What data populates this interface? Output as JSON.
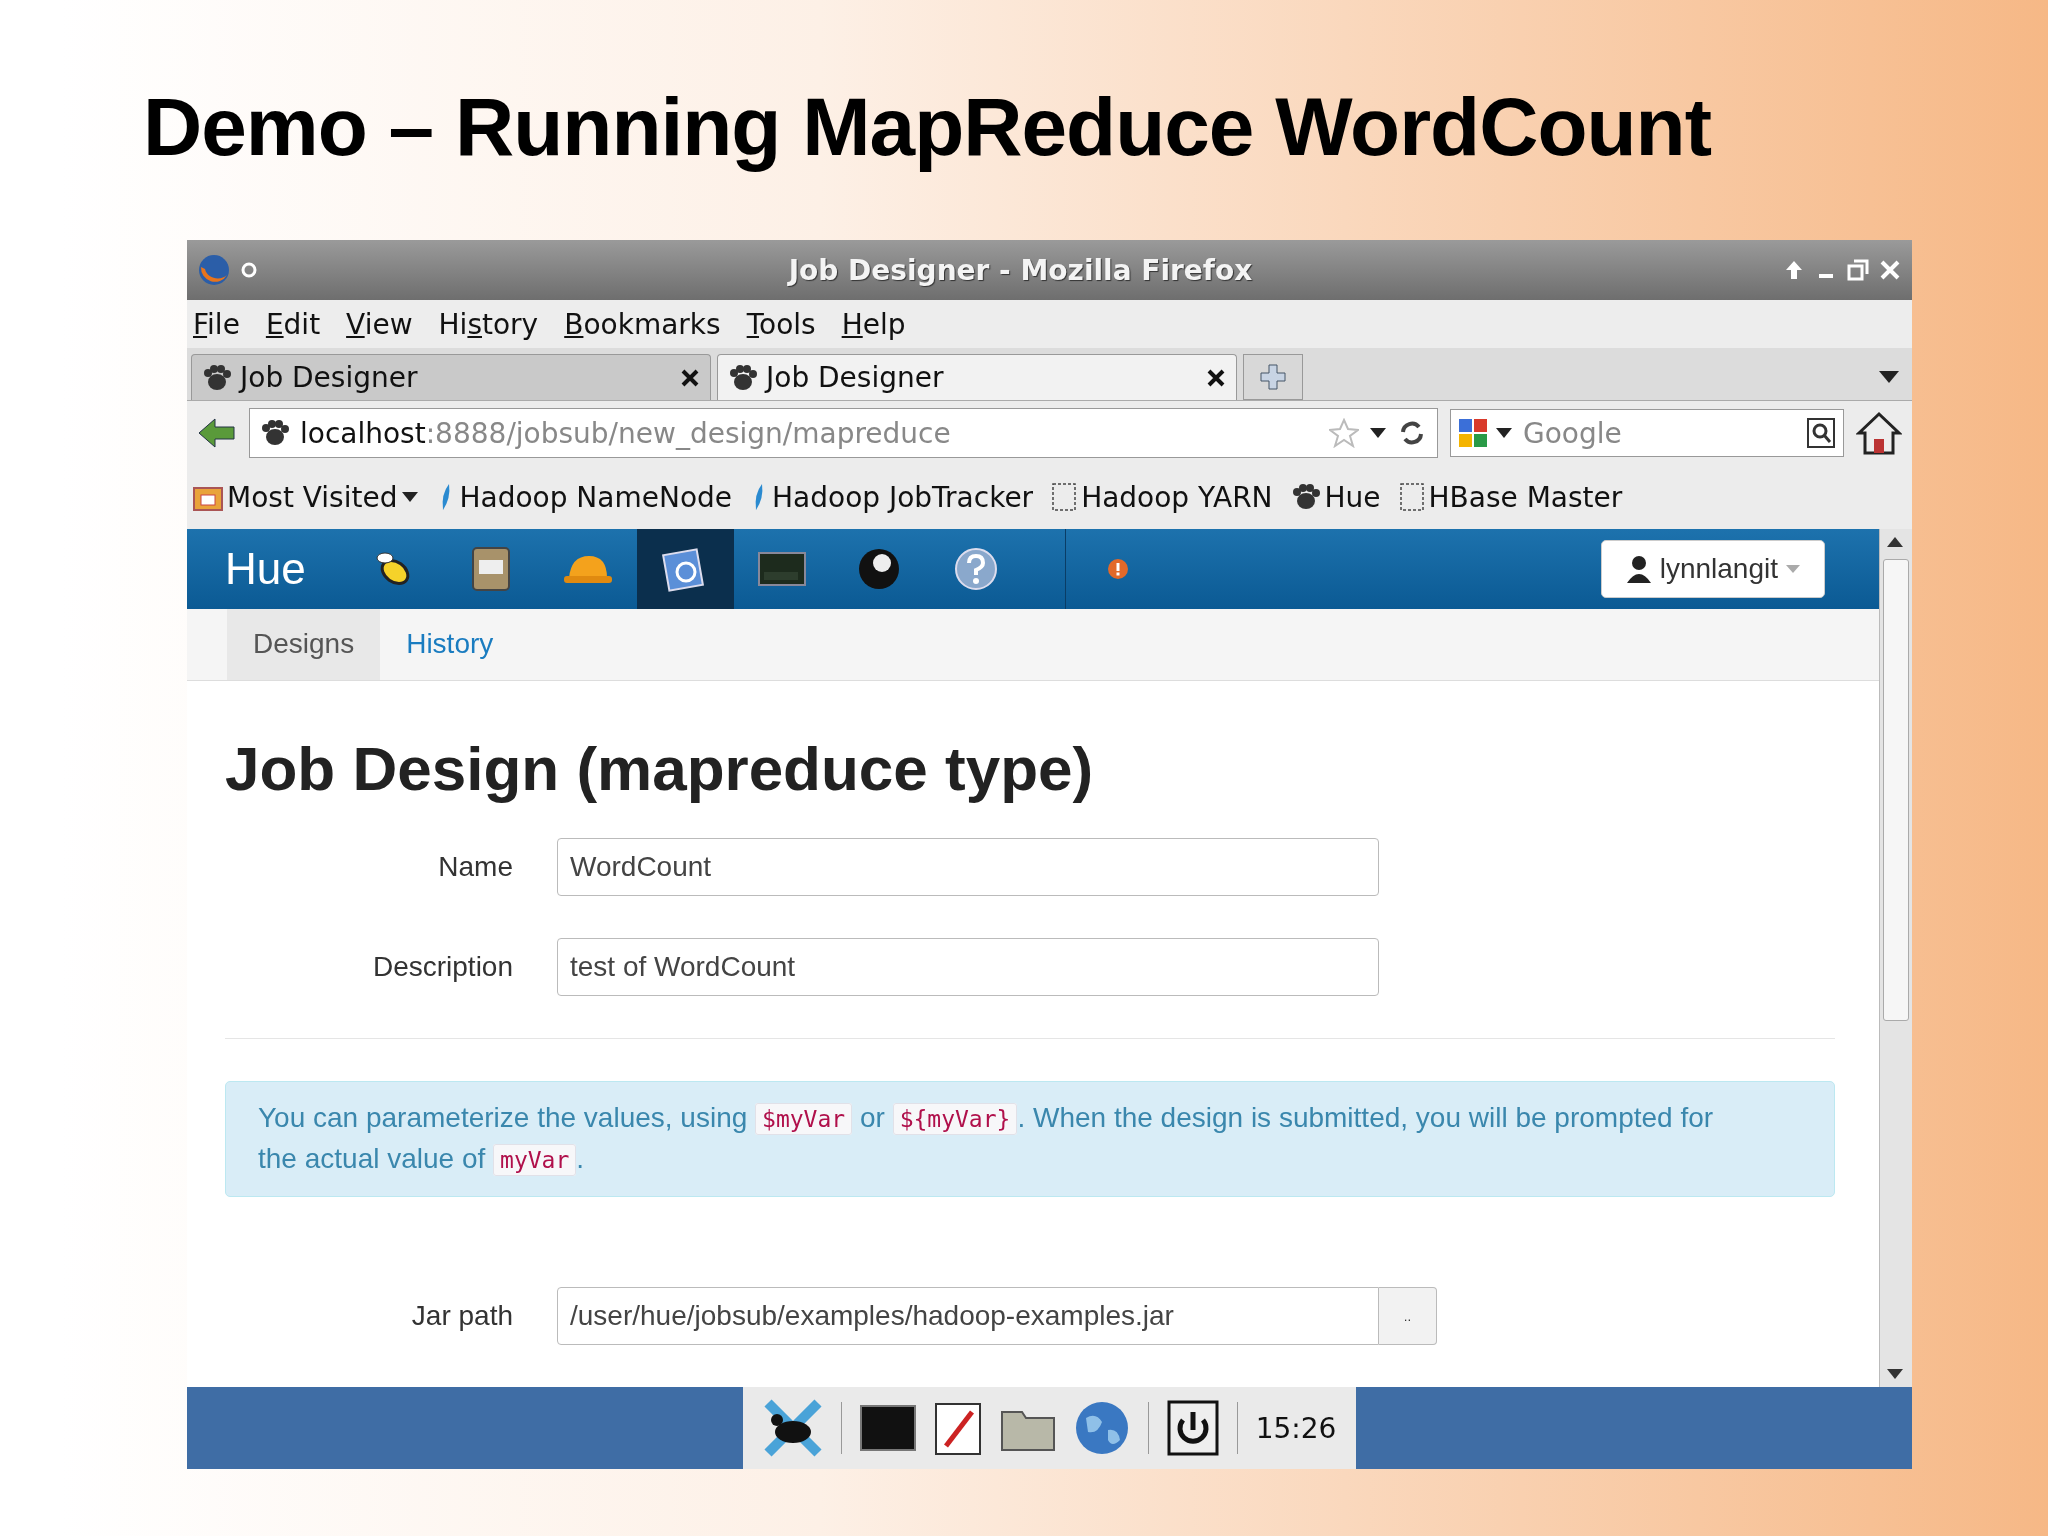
{
  "slide_title": "Demo – Running MapReduce WordCount",
  "window": {
    "title": "Job Designer - Mozilla Firefox"
  },
  "menu": [
    {
      "key": "F",
      "after": "ile"
    },
    {
      "key": "E",
      "after": "dit"
    },
    {
      "key": "V",
      "after": "iew"
    },
    {
      "before": "Hi",
      "key": "s",
      "after": "tory"
    },
    {
      "key": "B",
      "after": "ookmarks"
    },
    {
      "key": "T",
      "after": "ools"
    },
    {
      "key": "H",
      "after": "elp"
    }
  ],
  "tabs": [
    {
      "label": "Job Designer",
      "selected": false
    },
    {
      "label": "Job Designer",
      "selected": true
    }
  ],
  "address": {
    "host": "localhost",
    "path": ":8888/jobsub/new_design/mapreduce"
  },
  "search": {
    "placeholder": "Google"
  },
  "bookmarks": [
    {
      "label": "Most Visited",
      "kind": "folder"
    },
    {
      "label": "Hadoop NameNode",
      "kind": "feather"
    },
    {
      "label": "Hadoop JobTracker",
      "kind": "feather"
    },
    {
      "label": "Hadoop YARN",
      "kind": "blank"
    },
    {
      "label": "Hue",
      "kind": "paw"
    },
    {
      "label": "HBase Master",
      "kind": "blank"
    }
  ],
  "hue": {
    "brand": "Hue",
    "apps": [
      {
        "kind": "beeswax",
        "selected": false
      },
      {
        "kind": "filebrowser",
        "selected": false
      },
      {
        "kind": "hat",
        "selected": false
      },
      {
        "kind": "designer",
        "selected": true
      },
      {
        "kind": "shell",
        "selected": false
      },
      {
        "kind": "user",
        "selected": false
      },
      {
        "kind": "help",
        "selected": false
      }
    ],
    "user": "lynnlangit"
  },
  "subnav": [
    {
      "label": "Designs",
      "selected": true
    },
    {
      "label": "History",
      "selected": false
    }
  ],
  "heading": "Job Design (mapreduce type)",
  "fields": [
    {
      "label": "Name",
      "value": "WordCount"
    },
    {
      "label": "Description",
      "value": "test of WordCount"
    }
  ],
  "info": [
    {
      "kind": "text",
      "text": "You can parameterize the values, using "
    },
    {
      "kind": "code",
      "text": "$myVar"
    },
    {
      "kind": "text",
      "text": " or "
    },
    {
      "kind": "code",
      "text": "${myVar}"
    },
    {
      "kind": "text",
      "text": ". When the design is submitted, you will be prompted for the actual value of "
    },
    {
      "kind": "code",
      "text": "myVar"
    },
    {
      "kind": "text",
      "text": "."
    }
  ],
  "jar": {
    "label": "Jar path",
    "value": "/user/hue/jobsub/examples/hadoop-examples.jar",
    "browse": ".."
  },
  "taskbar": {
    "clock": "15:26"
  }
}
